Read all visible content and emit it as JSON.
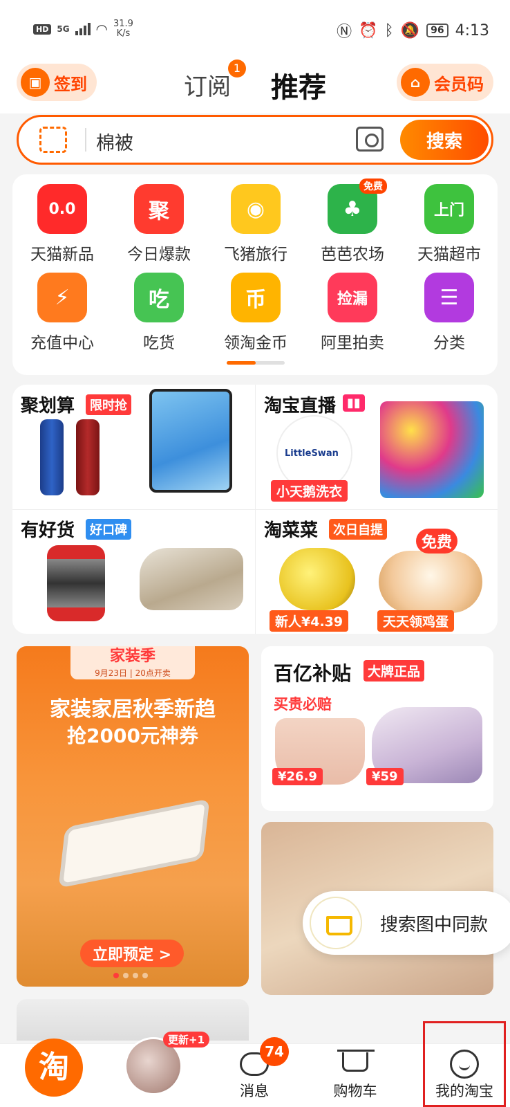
{
  "status_bar": {
    "hd": "HD",
    "net": "5G",
    "speed_value": "31.9",
    "speed_unit": "K/s",
    "battery": "96",
    "time": "4:13"
  },
  "header": {
    "checkin_label": "签到",
    "tab_subscribe": "订阅",
    "tab_subscribe_badge": "1",
    "tab_recommend": "推荐",
    "member_label": "会员码"
  },
  "search": {
    "value": "棉被",
    "button_label": "搜索"
  },
  "grid": {
    "items": [
      {
        "label": "天猫新品",
        "icon": "tmall-new-icon",
        "color": "#ff2a2a",
        "glyph": "0.0"
      },
      {
        "label": "今日爆款",
        "icon": "juhuasuan-icon",
        "color": "#ff3b2f",
        "glyph": "聚"
      },
      {
        "label": "飞猪旅行",
        "icon": "fliggy-icon",
        "color": "#ffc81e",
        "glyph": "◉"
      },
      {
        "label": "芭芭农场",
        "icon": "farm-icon",
        "color": "#2db34a",
        "glyph": "♣",
        "badge": "免费"
      },
      {
        "label": "天猫超市",
        "icon": "tmall-supermarket-icon",
        "color": "#3ec23e",
        "glyph": "上门"
      },
      {
        "label": "充值中心",
        "icon": "recharge-icon",
        "color": "#ff7a1e",
        "glyph": "⚡"
      },
      {
        "label": "吃货",
        "icon": "foodie-icon",
        "color": "#46c453",
        "glyph": "吃"
      },
      {
        "label": "领淘金币",
        "icon": "taobao-coin-icon",
        "color": "#ffb400",
        "glyph": "币"
      },
      {
        "label": "阿里拍卖",
        "icon": "auction-icon",
        "color": "#ff3a5a",
        "glyph": "捡漏"
      },
      {
        "label": "分类",
        "icon": "category-icon",
        "color": "#b23adf",
        "glyph": "☰"
      }
    ]
  },
  "promo": {
    "juhuasuan": {
      "title": "聚划算",
      "tag": "限时抢"
    },
    "live": {
      "title": "淘宝直播",
      "label": "小天鹅洗衣",
      "brand": "LittleSwan"
    },
    "haohuo": {
      "title": "有好货",
      "tag": "好口碑"
    },
    "taocaicai": {
      "title": "淘菜菜",
      "tag": "次日自提",
      "label_left": "新人¥4.39",
      "label_right": "天天领鸡蛋",
      "free_badge": "免费"
    }
  },
  "feed": {
    "banner": {
      "tag": "家装季",
      "tag_sub": "9月23日 | 20点开卖",
      "headline": "家装家居秋季新趋",
      "subline": "抢2000元神券",
      "button": "立即预定 >"
    },
    "subsidy": {
      "title": "百亿补贴",
      "tag": "大牌正品",
      "slogan": "买贵必赔",
      "price_left": "¥26.9",
      "price_right": "¥59"
    },
    "popup_text": "搜索图中同款"
  },
  "bottom_nav": {
    "avatar_badge": "更新+1",
    "messages_label": "消息",
    "messages_badge": "74",
    "cart_label": "购物车",
    "me_label": "我的淘宝",
    "home_glyph": "淘"
  }
}
